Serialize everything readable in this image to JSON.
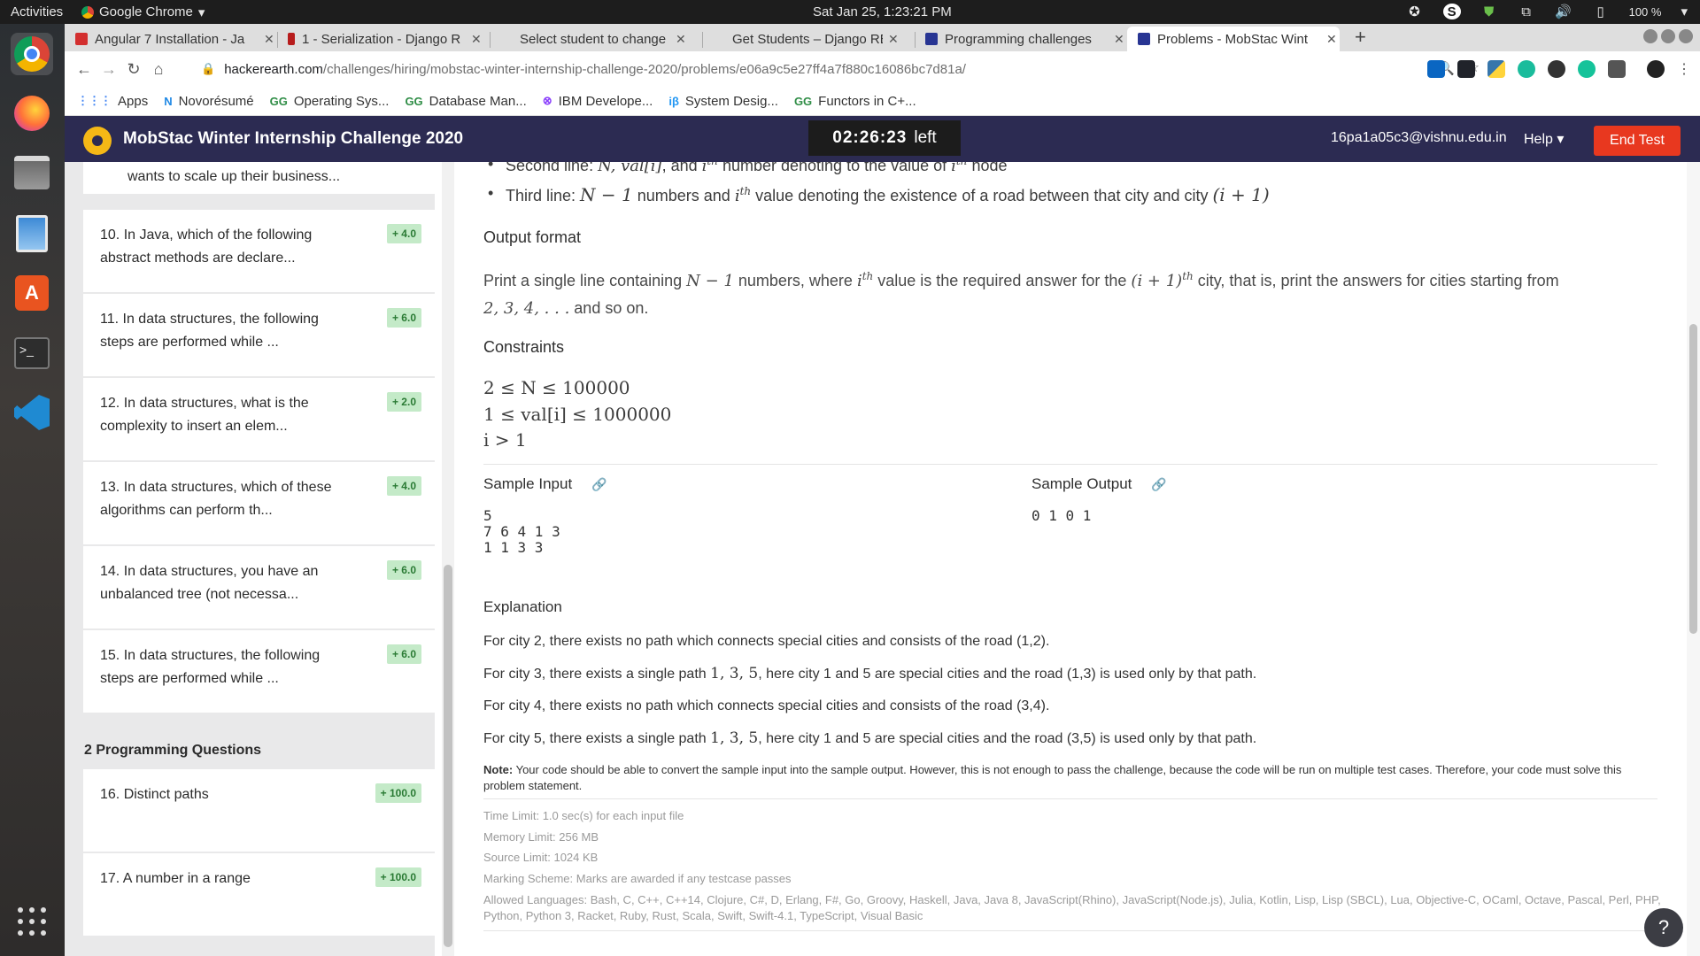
{
  "os": {
    "activities": "Activities",
    "app_name": "Google Chrome",
    "clock": "Sat Jan 25,  1:23:21 PM",
    "battery": "100 %"
  },
  "tabs": [
    {
      "label": "Angular 7 Installation - Ja",
      "color": "#d32f2f"
    },
    {
      "label": "1 - Serialization - Django R",
      "color": "#b71c1c"
    },
    {
      "label": "Select student to change",
      "color": "#dedede"
    },
    {
      "label": "Get Students – Django RE",
      "color": "#dedede"
    },
    {
      "label": "Programming challenges",
      "color": "#283593"
    },
    {
      "label": "Problems - MobStac Wint",
      "color": "#283593"
    }
  ],
  "url": {
    "domain": "hackerearth.com",
    "path": "/challenges/hiring/mobstac-winter-internship-challenge-2020/problems/e06a9c5e27ff4a7f880c16086bc7d81a/"
  },
  "bookmarks": [
    "Apps",
    "Novorésumé",
    "Operating Sys...",
    "Database Man...",
    "IBM Develope...",
    "System Desig...",
    "Functors in C+..."
  ],
  "header": {
    "title": "MobStac Winter Internship Challenge 2020",
    "timer": "02:26:23",
    "timer_suffix": "left",
    "email": "16pa1a05c3@vishnu.edu.in",
    "help": "Help",
    "end_test": "End Test"
  },
  "questions": [
    {
      "text": "wants to scale up their business...",
      "badge": ""
    },
    {
      "text": "10. In Java, which of the following abstract methods are declare...",
      "badge": "+ 4.0"
    },
    {
      "text": "11. In data structures, the following steps are performed while ...",
      "badge": "+ 6.0"
    },
    {
      "text": "12. In data structures, what is the complexity to insert an elem...",
      "badge": "+ 2.0"
    },
    {
      "text": "13. In data structures, which of these algorithms can perform th...",
      "badge": "+ 4.0"
    },
    {
      "text": "14. In data structures, you have an unbalanced tree (not necessa...",
      "badge": "+ 6.0"
    },
    {
      "text": "15. In data structures, the following steps are performed while ...",
      "badge": "+ 6.0"
    }
  ],
  "programming_section": "2 Programming Questions",
  "programming": [
    {
      "text": "16. Distinct paths",
      "badge": "+ 100.0"
    },
    {
      "text": "17. A number in a range",
      "badge": "+ 100.0"
    }
  ],
  "problem": {
    "second_line_a": "Second line: ",
    "second_line_math": "N, val[i]",
    "second_line_b": ", and ",
    "second_line_c": " number denoting to the value of ",
    "second_line_d": " node",
    "third_line_a": "Third line: ",
    "third_line_math1": "N − 1",
    "third_line_b": " numbers and ",
    "third_line_math2": "i",
    "third_line_sup": "th",
    "third_line_c": " value denoting the existence of a road between that city and city ",
    "third_line_math3": "(i + 1)",
    "output_heading": "Output format",
    "output_a": "Print a single line containing ",
    "output_m1": "N − 1",
    "output_b": " numbers, where ",
    "output_m2": "i",
    "output_c": " value is the required answer for the ",
    "output_m3": "(i + 1)",
    "output_d": " city, that is, print the answers for cities starting from",
    "output_m4": "2, 3, 4, . . .",
    "output_e": " and so on.",
    "constraints_heading": "Constraints",
    "c1": "2 ≤ N ≤ 100000",
    "c2": "1 ≤ val[i] ≤ 1000000",
    "c3": "i > 1",
    "sample_input_label": "Sample Input",
    "sample_input": "5\n7 6 4 1 3\n1 1 3 3",
    "sample_output_label": "Sample Output",
    "sample_output": "0 1 0 1",
    "explanation_heading": "Explanation",
    "e1": "For city 2, there exists no path which connects special cities and consists of the road (1,2).",
    "e2a": "For city 3, there exists a single path ",
    "e2m": "1, 3, 5",
    "e2b": ", here city 1 and 5 are special cities and the road (1,3) is used only by that path.",
    "e3": "For city 4, there exists no path which connects special cities and consists of the road (3,4).",
    "e4a": "For city 5, there exists a single path ",
    "e4m": "1, 3, 5",
    "e4b": ", here city 1 and 5 are special cities and the road (3,5) is used only by that path.",
    "note_label": "Note:",
    "note": " Your code should be able to convert the sample input into the sample output. However, this is not enough to pass the challenge, because the code will be run on multiple test cases. Therefore, your code must solve this problem statement.",
    "time_limit": "Time Limit: 1.0 sec(s) for each input file",
    "memory_limit": "Memory Limit: 256 MB",
    "source_limit": "Source Limit: 1024 KB",
    "marking": "Marking Scheme: Marks are awarded if any testcase passes",
    "languages": "Allowed Languages: Bash, C, C++, C++14, Clojure, C#, D, Erlang, F#, Go, Groovy, Haskell, Java, Java 8, JavaScript(Rhino), JavaScript(Node.js), Julia, Kotlin, Lisp, Lisp (SBCL), Lua, Objective-C, OCaml, Octave, Pascal, Perl, PHP, Python, Python 3, Racket, Ruby, Rust, Scala, Swift, Swift-4.1, TypeScript, Visual Basic"
  }
}
